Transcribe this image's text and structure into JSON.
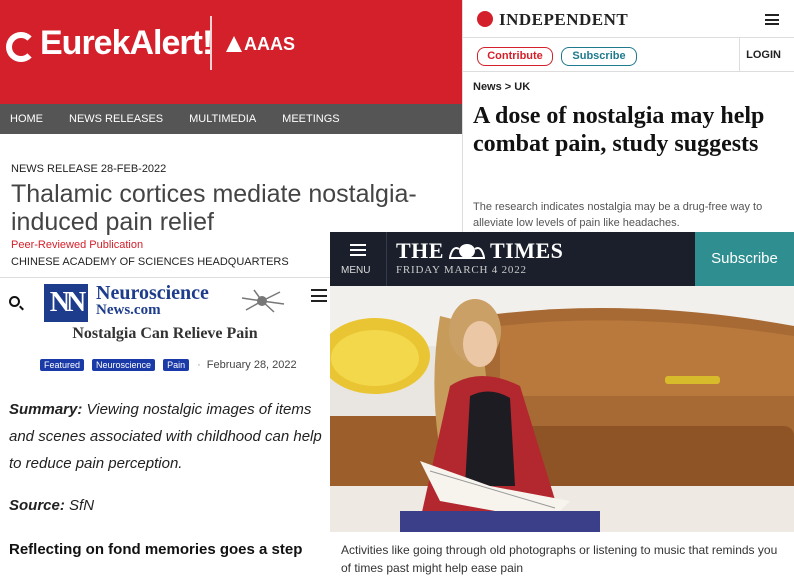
{
  "eurekalert": {
    "logo": "EurekAlert!",
    "partner": "AAAS",
    "nav": [
      "HOME",
      "NEWS RELEASES",
      "MULTIMEDIA",
      "MEETINGS"
    ],
    "meta": "NEWS RELEASE 28-FEB-2022",
    "headline": "Thalamic cortices mediate nostalgia-induced pain relief",
    "peer_reviewed": "Peer-Reviewed Publication",
    "institution": "CHINESE ACADEMY OF SCIENCES HEADQUARTERS",
    "colors": {
      "brand": "#d4202a",
      "nav": "#555555"
    }
  },
  "independent": {
    "brand": "INDEPENDENT",
    "contribute_label": "Contribute",
    "subscribe_label": "Subscribe",
    "login_label": "LOGIN",
    "breadcrumb": "News > UK",
    "headline": "A dose of nostalgia may help combat pain, study suggests",
    "standfirst": "The research indicates nostalgia may be a drug-free way to alleviate low levels of pain like headaches."
  },
  "neuroscience": {
    "brand_line1": "Neuroscience",
    "brand_line2": "News.com",
    "logo_letters": "NN",
    "title": "Nostalgia Can Relieve Pain",
    "tags": [
      "Featured",
      "Neuroscience",
      "Pain"
    ],
    "date_sep": "·",
    "date": "February 28, 2022",
    "summary_label": "Summary:",
    "summary_text": " Viewing nostalgic images of items and scenes associated with childhood can help to reduce pain perception.",
    "source_label": "Source:",
    "source_text": " SfN",
    "lead": "Reflecting on fond memories goes a step"
  },
  "times": {
    "menu_label": "MENU",
    "brand_left": "THE",
    "brand_right": "TIMES",
    "dateline": "FRIDAY MARCH 4 2022",
    "subscribe_label": "Subscribe",
    "caption": "Activities like going through old photographs or listening to music that reminds you of times past might help ease pain",
    "colors": {
      "bar": "#1a1f2b",
      "subscribe": "#2e8e90"
    }
  }
}
